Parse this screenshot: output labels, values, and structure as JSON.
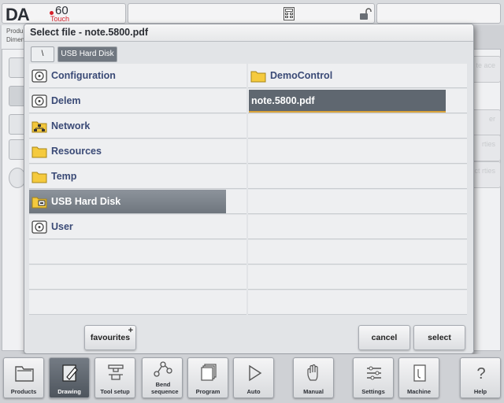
{
  "topbar": {
    "logo_brand": "DA",
    "logo_model": "60",
    "logo_sub": "Touch"
  },
  "background": {
    "info_line1": "Produ",
    "info_line2": "Dimen",
    "right_btn1": "te ace",
    "right_btn2": "er",
    "right_btn3": "rties",
    "right_btn4": "uct rties"
  },
  "dialog": {
    "title": "Select file - note.5800.pdf",
    "breadcrumb_root": "\\",
    "breadcrumb_current": "USB Hard Disk",
    "folders": [
      {
        "label": "Configuration",
        "icon": "disk-icon"
      },
      {
        "label": "Delem",
        "icon": "disk-icon"
      },
      {
        "label": "Network",
        "icon": "network-icon"
      },
      {
        "label": "Resources",
        "icon": "folder-icon"
      },
      {
        "label": "Temp",
        "icon": "folder-icon"
      },
      {
        "label": "USB Hard Disk",
        "icon": "usb-folder-icon",
        "selected": true
      },
      {
        "label": "User",
        "icon": "disk-icon"
      }
    ],
    "files": [
      {
        "label": "DemoControl",
        "icon": "folder-icon"
      },
      {
        "label": "note.5800.pdf",
        "selected": true
      }
    ],
    "favourites_label": "favourites",
    "favourites_plus": "+",
    "cancel_label": "cancel",
    "select_label": "select"
  },
  "nav": {
    "products": "Products",
    "drawing": "Drawing",
    "tool_setup": "Tool setup",
    "bend_sequence": "Bend sequence",
    "program": "Program",
    "auto": "Auto",
    "manual": "Manual",
    "settings": "Settings",
    "machine": "Machine",
    "help": "Help"
  },
  "colors": {
    "accent": "#3a4a76",
    "selected_row": "#6f767e",
    "file_selected": "#5f6770",
    "selection_underline": "#d9a33a",
    "logo_red": "#d6202a"
  }
}
